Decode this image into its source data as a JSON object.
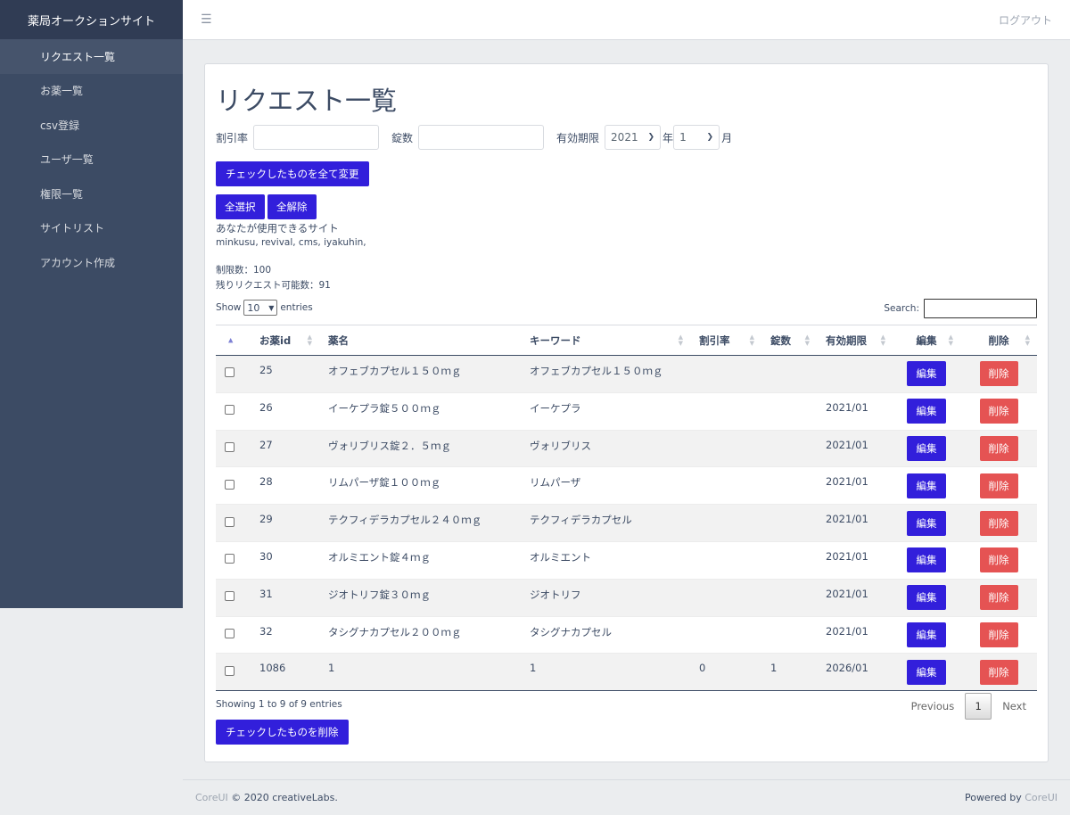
{
  "sidebar": {
    "brand": "薬局オークションサイト",
    "items": [
      {
        "label": "リクエスト一覧"
      },
      {
        "label": "お薬一覧"
      },
      {
        "label": "csv登録"
      },
      {
        "label": "ユーザ一覧"
      },
      {
        "label": "権限一覧"
      },
      {
        "label": "サイトリスト"
      },
      {
        "label": "アカウント作成"
      }
    ]
  },
  "header": {
    "menu_icon": "hamburger-icon",
    "logout": "ログアウト"
  },
  "main": {
    "title": "リクエスト一覧",
    "filters": {
      "discount_label": "割引率",
      "tablets_label": "錠数",
      "expiry_label": "有効期限",
      "year_value": "2021",
      "year_suffix": "年",
      "month_value": "1",
      "month_suffix": "月"
    },
    "change_checked_button": "チェックしたものを全て変更",
    "select_all_button": "全選択",
    "deselect_all_button": "全解除",
    "sites_label": "あなたが使用できるサイト",
    "sites_value": "minkusu, revival, cms, iyakuhin,",
    "limit_text": "制限数：100",
    "remaining_text": "残りリクエスト可能数：91",
    "length": {
      "show": "Show",
      "value": "10",
      "entries": "entries"
    },
    "search_label": "Search:",
    "table": {
      "headers": [
        "",
        "お薬id",
        "薬名",
        "キーワード",
        "割引率",
        "錠数",
        "有効期限",
        "編集",
        "削除"
      ],
      "rows": [
        {
          "id": "25",
          "name": "オフェブカプセル１５０ｍｇ",
          "keyword": "オフェブカプセル１５０ｍｇ",
          "discount": "",
          "tablets": "",
          "expiry": ""
        },
        {
          "id": "26",
          "name": "イーケプラ錠５００ｍｇ",
          "keyword": "イーケプラ",
          "discount": "",
          "tablets": "",
          "expiry": "2021/01"
        },
        {
          "id": "27",
          "name": "ヴォリブリス錠２．５ｍｇ",
          "keyword": "ヴォリブリス",
          "discount": "",
          "tablets": "",
          "expiry": "2021/01"
        },
        {
          "id": "28",
          "name": "リムパーザ錠１００ｍｇ",
          "keyword": "リムパーザ",
          "discount": "",
          "tablets": "",
          "expiry": "2021/01"
        },
        {
          "id": "29",
          "name": "テクフィデラカプセル２４０ｍｇ",
          "keyword": "テクフィデラカプセル",
          "discount": "",
          "tablets": "",
          "expiry": "2021/01"
        },
        {
          "id": "30",
          "name": "オルミエント錠４ｍｇ",
          "keyword": "オルミエント",
          "discount": "",
          "tablets": "",
          "expiry": "2021/01"
        },
        {
          "id": "31",
          "name": "ジオトリフ錠３０ｍｇ",
          "keyword": "ジオトリフ",
          "discount": "",
          "tablets": "",
          "expiry": "2021/01"
        },
        {
          "id": "32",
          "name": "タシグナカプセル２００ｍｇ",
          "keyword": "タシグナカプセル",
          "discount": "",
          "tablets": "",
          "expiry": "2021/01"
        },
        {
          "id": "1086",
          "name": "1",
          "keyword": "1",
          "discount": "0",
          "tablets": "1",
          "expiry": "2026/01"
        }
      ],
      "edit_label": "編集",
      "delete_label": "削除"
    },
    "showing_text": "Showing 1 to 9 of 9 entries",
    "pagination": {
      "previous": "Previous",
      "current": "1",
      "next": "Next"
    },
    "delete_checked_button": "チェックしたものを削除"
  },
  "footer": {
    "brand_link": "CoreUI",
    "copyright": "© 2020 creativeLabs.",
    "powered_by": "Powered by",
    "powered_link": "CoreUI"
  },
  "colors": {
    "primary": "#321fdb",
    "danger": "#e55353",
    "sidebar": "#3c4b64"
  }
}
